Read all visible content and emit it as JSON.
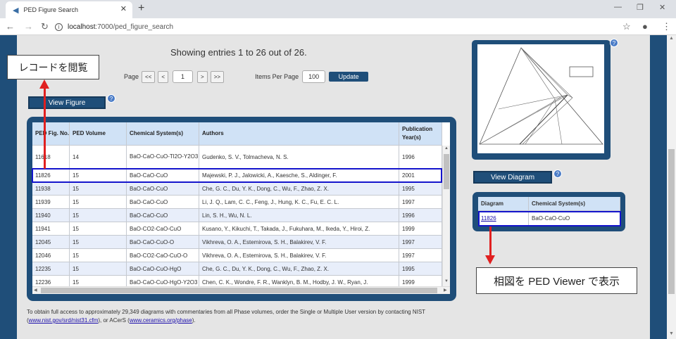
{
  "browser": {
    "tab_title": "PED Figure Search",
    "url_host": "localhost",
    "url_path": ":7000/ped_figure_search"
  },
  "heading": "Showing entries 1 to 26 out of 26.",
  "pager": {
    "label": "Page",
    "first": "<<",
    "prev": "<",
    "page": "1",
    "next": ">",
    "last": ">>",
    "items_label": "Items Per Page",
    "items_value": "100",
    "update": "Update"
  },
  "view_figure": "View Figure",
  "view_diagram": "View Diagram",
  "help": "?",
  "table": {
    "headers": [
      "PED Fig. No.",
      "PED Volume",
      "Chemical System(s)",
      "Authors",
      "Publication Year(s)"
    ],
    "rows": [
      [
        "11618",
        "14",
        "BaO-CaO-CuO-Tl2O-Y2O3",
        "Gudenko, S. V., Tolmacheva, N. S.",
        "1996"
      ],
      [
        "11826",
        "15",
        "BaO-CaO-CuO",
        "Majewski, P. J., Jalowicki, A., Kaesche, S., Aldinger, F.",
        "2001"
      ],
      [
        "11938",
        "15",
        "BaO-CaO-CuO",
        "Che, G. C., Du, Y. K., Dong, C., Wu, F., Zhao, Z. X.",
        "1995"
      ],
      [
        "11939",
        "15",
        "BaO-CaO-CuO",
        "Li, J. Q., Lam, C. C., Feng, J., Hung, K. C., Fu, E. C. L.",
        "1997"
      ],
      [
        "11940",
        "15",
        "BaO-CaO-CuO",
        "Lin, S. H., Wu, N. L.",
        "1996"
      ],
      [
        "11941",
        "15",
        "BaO-CO2-CaO-CuO",
        "Kusano, Y., Kikuchi, T., Takada, J., Fukuhara, M., Ikeda, Y., Hiroi, Z.",
        "1999"
      ],
      [
        "12045",
        "15",
        "BaO-CaO-CuO-O",
        "Vikhreva, O. A., Estemirova, S. H., Balakirev, V. F.",
        "1997"
      ],
      [
        "12046",
        "15",
        "BaO-CO2-CaO-CuO-O",
        "Vikhreva, O. A., Estemirova, S. H., Balakirev, V. F.",
        "1997"
      ],
      [
        "12235",
        "15",
        "BaO-CaO-CuO-HgO",
        "Che, G. C., Du, Y. K., Dong, C., Wu, F., Zhao, Z. X.",
        "1995"
      ],
      [
        "12236",
        "15",
        "BaO-CaO-CuO-HgO-Y2O3",
        "Chen, C. K., Wondre, F. R., Wanklyn, B. M., Hodby, J. W., Ryan, J.",
        "1999"
      ]
    ]
  },
  "diagram_table": {
    "headers": [
      "Diagram",
      "Chemical System(s)"
    ],
    "row": [
      "11826",
      "BaO-CaO-CuO"
    ]
  },
  "annotations": {
    "record": "レコードを閲覧",
    "viewer": "相図を PED Viewer で表示"
  },
  "footer": {
    "text1": "To obtain full access to approximately 29,349 diagrams with commentaries from all Phase volumes, order the Single or Multiple User version by contacting NIST (",
    "link1": "www.nist.gov/srd/nist31.cfm",
    "text2": "), or ACerS (",
    "link2": "www.ceramics.org/phase",
    "text3": ")."
  }
}
